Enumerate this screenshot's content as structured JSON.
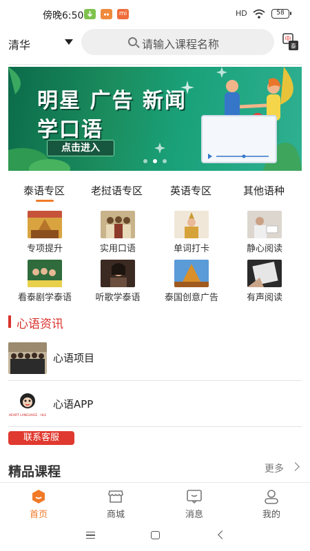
{
  "status_bar": {
    "time": "傍晚6:50",
    "notif3": "mi",
    "signal": "HD",
    "battery": "58"
  },
  "header": {
    "city": "清华",
    "search_placeholder": "请输入课程名称",
    "translate_icon_text": "中",
    "translate_icon_text_b": "泰"
  },
  "banner": {
    "title_line1": "明星 广告 新闻",
    "title_line2": "学口语",
    "button": "点击进入",
    "slide_count": 3,
    "active_slide": 2
  },
  "tabs": [
    {
      "label": "泰语专区",
      "active": true
    },
    {
      "label": "老挝语专区",
      "active": false
    },
    {
      "label": "英语专区",
      "active": false
    },
    {
      "label": "其他语种",
      "active": false
    }
  ],
  "grid": [
    {
      "label": "专项提升",
      "icon": "temple-image"
    },
    {
      "label": "实用口语",
      "icon": "group-photo-image"
    },
    {
      "label": "单词打卡",
      "icon": "thai-dancer-image"
    },
    {
      "label": "静心阅读",
      "icon": "reading-woman-image"
    },
    {
      "label": "看泰剧学泰语",
      "icon": "drama-poster-image"
    },
    {
      "label": "听歌学泰语",
      "icon": "singer-image"
    },
    {
      "label": "泰国创意广告",
      "icon": "thai-temple-ad-image"
    },
    {
      "label": "有声阅读",
      "icon": "tablet-reading-image"
    }
  ],
  "news": {
    "title": "心语资讯",
    "items": [
      {
        "label": "心语项目",
        "icon": "team-photo-image"
      },
      {
        "label": "心语APP",
        "icon": "monkey-logo-image",
        "logo_text": "HEART LANGUAGE · HLE"
      }
    ]
  },
  "contact_button": "联系客服",
  "featured": {
    "title": "精品课程",
    "more": "更多"
  },
  "bottom_nav": [
    {
      "label": "首页",
      "icon": "home-icon",
      "active": true
    },
    {
      "label": "商城",
      "icon": "shop-icon",
      "active": false
    },
    {
      "label": "消息",
      "icon": "message-icon",
      "active": false
    },
    {
      "label": "我的",
      "icon": "profile-icon",
      "active": false
    }
  ],
  "colors": {
    "accent": "#f07a28",
    "news_red": "#d8322c",
    "banner_green": "#1b8d5e"
  }
}
